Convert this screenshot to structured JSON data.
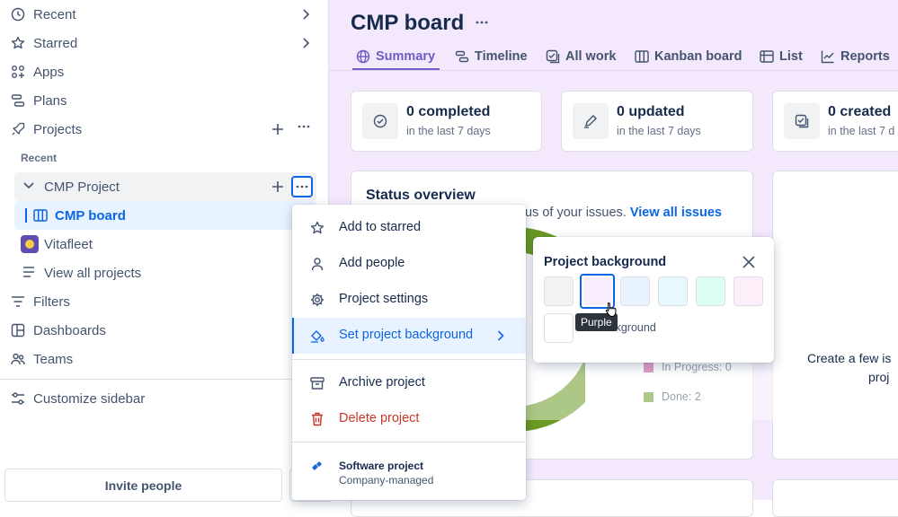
{
  "sidebar": {
    "recent": "Recent",
    "starred": "Starred",
    "apps": "Apps",
    "plans": "Plans",
    "projects": "Projects",
    "recent_section": "Recent",
    "cmp_project": "CMP Project",
    "cmp_board": "CMP board",
    "vitafleet": "Vitafleet",
    "view_all_projects": "View all projects",
    "filters": "Filters",
    "dashboards": "Dashboards",
    "teams": "Teams",
    "customize_sidebar": "Customize sidebar",
    "invite_people": "Invite people"
  },
  "header": {
    "title": "CMP board",
    "tabs": [
      "Summary",
      "Timeline",
      "All work",
      "Kanban board",
      "List",
      "Reports"
    ]
  },
  "stats": [
    {
      "value": "0 completed",
      "sub": "in the last 7 days"
    },
    {
      "value": "0 updated",
      "sub": "in the last 7 days"
    },
    {
      "value": "0 created",
      "sub": "in the last 7 d"
    }
  ],
  "status_overview": {
    "title": "Status overview",
    "desc": "us of your issues.",
    "link": "View all issues",
    "legend": [
      {
        "label": "In Progress: 0",
        "color": "#cd519d"
      },
      {
        "label": "Done: 2",
        "color": "#6a9a23"
      }
    ],
    "donut_color": "#6a9a23"
  },
  "right_panel": {
    "text1": "Create a few is",
    "text2": "proj"
  },
  "context_menu": {
    "items": [
      {
        "label": "Add to starred"
      },
      {
        "label": "Add people"
      },
      {
        "label": "Project settings"
      },
      {
        "label": "Set project background"
      },
      {
        "label": "Archive project"
      },
      {
        "label": "Delete project"
      }
    ],
    "footer_title": "Software project",
    "footer_sub": "Company-managed"
  },
  "background_popover": {
    "title": "Project background",
    "tooltip": "Purple",
    "no_background": "No background",
    "swatch_colors": [
      "#f1f2f4",
      "#f8eefe",
      "#e9f2ff",
      "#e7f8ff",
      "#dcfff1",
      "#fdeffa"
    ]
  },
  "colors": {
    "accent": "#0c66e4",
    "danger": "#c9372c",
    "tab_accent": "#6e5dc6"
  }
}
